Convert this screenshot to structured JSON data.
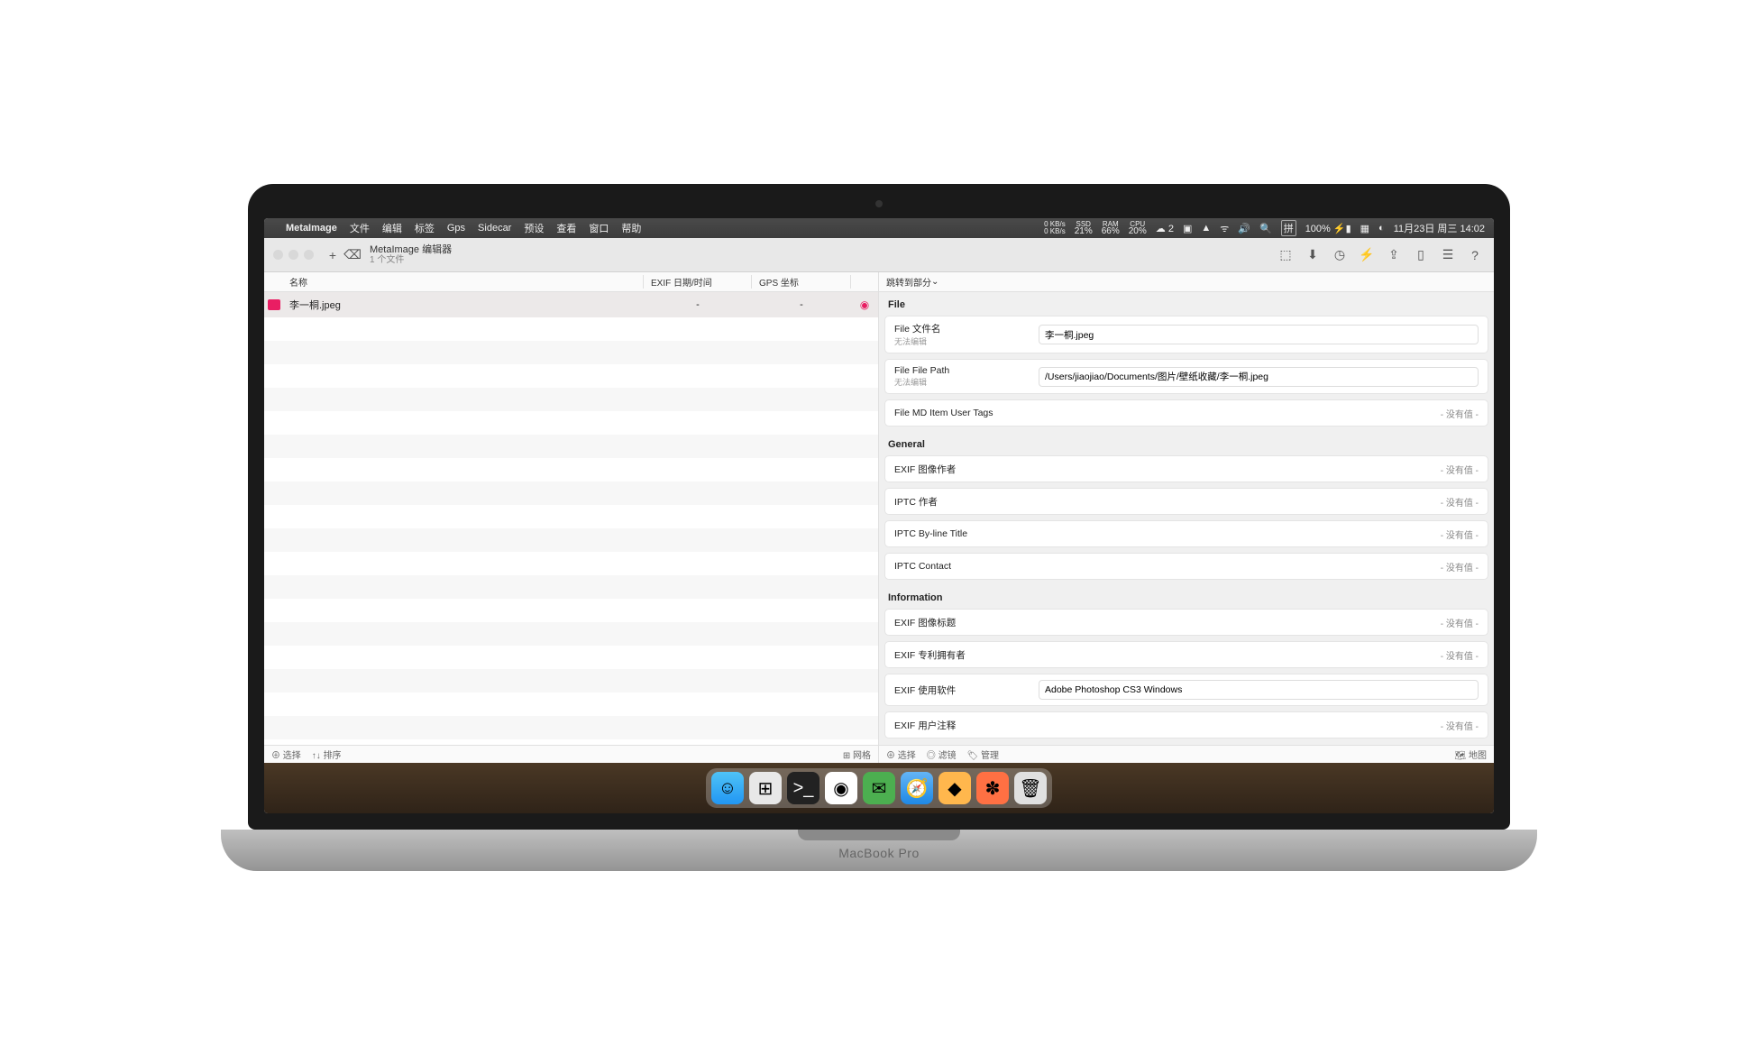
{
  "menubar": {
    "app": "MetaImage",
    "items": [
      "文件",
      "编辑",
      "标签",
      "Gps",
      "Sidecar",
      "预设",
      "查看",
      "窗口",
      "帮助"
    ],
    "stats": {
      "net_up": "0 KB/s",
      "net_down": "0 KB/s",
      "ssd": "21%",
      "ram": "66%",
      "cpu": "20%"
    },
    "wechat_badge": "2",
    "ime": "拼",
    "battery": "100%",
    "datetime": "11月23日 周三  14:02"
  },
  "titlebar": {
    "title": "MetaImage 编辑器",
    "subtitle": "1 个文件"
  },
  "columns": {
    "name": "名称",
    "exif_date": "EXIF 日期/时间",
    "gps": "GPS 坐标"
  },
  "file": {
    "name": "李一桐.jpeg",
    "exif_date": "-",
    "gps": "-"
  },
  "jump": "跳转到部分",
  "sections": {
    "file": "File",
    "general": "General",
    "information": "Information"
  },
  "fields": {
    "file_name_label": "File 文件名",
    "file_name_sub": "无法编辑",
    "file_name_value": "李一桐.jpeg",
    "file_path_label": "File File Path",
    "file_path_sub": "无法编辑",
    "file_path_value": "/Users/jiaojiao/Documents/图片/壁纸收藏/李一桐.jpeg",
    "file_tags_label": "File MD Item User Tags",
    "exif_author_label": "EXIF 图像作者",
    "iptc_author_label": "IPTC 作者",
    "iptc_byline_label": "IPTC By-line Title",
    "iptc_contact_label": "IPTC Contact",
    "exif_title_label": "EXIF 图像标题",
    "exif_patent_label": "EXIF 专利拥有者",
    "exif_software_label": "EXIF 使用软件",
    "exif_software_value": "Adobe Photoshop CS3 Windows",
    "exif_usercomment_label": "EXIF 用户注释",
    "no_value": "- 没有值 -"
  },
  "bottombar_left": {
    "select": "选择",
    "sort": "排序",
    "grid": "网格"
  },
  "bottombar_right": {
    "select": "选择",
    "filter": "滤镜",
    "manage": "管理",
    "map": "地图"
  },
  "laptop_label": "MacBook Pro"
}
